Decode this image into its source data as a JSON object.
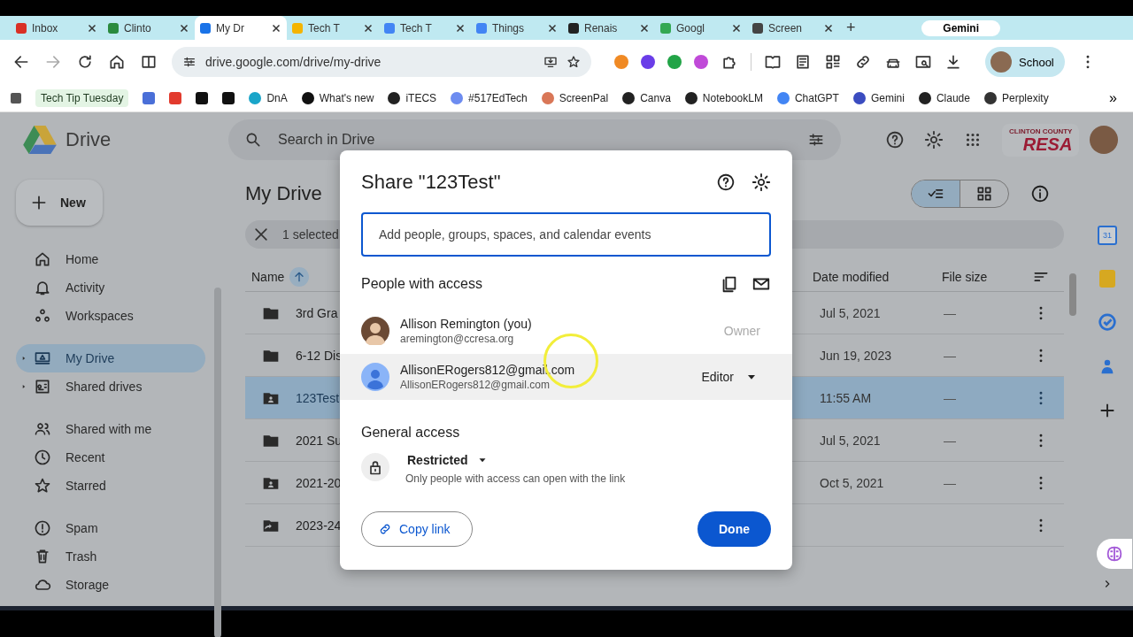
{
  "browser": {
    "tabs": [
      {
        "label": "Inbox",
        "selected": false
      },
      {
        "label": "Clinto",
        "selected": false
      },
      {
        "label": "My Dr",
        "selected": true
      },
      {
        "label": "Tech T",
        "selected": false
      },
      {
        "label": "Tech T",
        "selected": false
      },
      {
        "label": "Things",
        "selected": false
      },
      {
        "label": "Renais",
        "selected": false
      },
      {
        "label": "Googl",
        "selected": false
      },
      {
        "label": "Screen",
        "selected": false
      }
    ],
    "new_tab": "+",
    "gemini": "Gemini",
    "url": "drive.google.com/drive/my-drive",
    "profile": "School",
    "bookmarks": [
      {
        "kind": "chip",
        "label": "Tech Tip Tuesday"
      },
      {
        "kind": "icon"
      },
      {
        "kind": "icon"
      },
      {
        "kind": "icon"
      },
      {
        "kind": "icon"
      },
      {
        "kind": "site",
        "label": "DnA"
      },
      {
        "kind": "site",
        "label": "What's new"
      },
      {
        "kind": "site",
        "label": "iTECS"
      },
      {
        "kind": "site",
        "label": "#517EdTech"
      },
      {
        "kind": "site",
        "label": "ScreenPal"
      },
      {
        "kind": "site",
        "label": "Canva"
      },
      {
        "kind": "site",
        "label": "NotebookLM"
      },
      {
        "kind": "site",
        "label": "ChatGPT"
      },
      {
        "kind": "site",
        "label": "Gemini"
      },
      {
        "kind": "site",
        "label": "Claude"
      },
      {
        "kind": "site",
        "label": "Perplexity"
      }
    ],
    "more": "»"
  },
  "drive": {
    "app_name": "Drive",
    "search_placeholder": "Search in Drive",
    "new_button": "New",
    "org": {
      "small": "CLINTON COUNTY",
      "big": "RESA"
    },
    "nav_groups": [
      [
        {
          "kind": "home",
          "label": "Home",
          "selected": false
        },
        {
          "kind": "bell",
          "label": "Activity",
          "selected": false
        },
        {
          "kind": "workspaces",
          "label": "Workspaces",
          "selected": false
        }
      ],
      [
        {
          "kind": "mydrive",
          "label": "My Drive",
          "selected": true,
          "expandable": true
        },
        {
          "kind": "shared",
          "label": "Shared drives",
          "selected": false,
          "expandable": true
        }
      ],
      [
        {
          "kind": "people",
          "label": "Shared with me",
          "selected": false
        },
        {
          "kind": "clock",
          "label": "Recent",
          "selected": false
        },
        {
          "kind": "star",
          "label": "Starred",
          "selected": false
        }
      ],
      [
        {
          "kind": "spam",
          "label": "Spam",
          "selected": false
        },
        {
          "kind": "trash",
          "label": "Trash",
          "selected": false
        },
        {
          "kind": "cloud",
          "label": "Storage",
          "selected": false
        }
      ]
    ],
    "title": "My Drive",
    "selection": "1 selected",
    "columns": {
      "name": "Name",
      "date": "Date modified",
      "size": "File size"
    },
    "rows": [
      {
        "kind": "folder",
        "name": "3rd Gra",
        "date": "Jul 5, 2021",
        "size": "—",
        "selected": false
      },
      {
        "kind": "folder",
        "name": "6-12 Dis",
        "date": "Jun 19, 2023",
        "size": "—",
        "selected": false
      },
      {
        "kind": "shared",
        "name": "123Test",
        "date": "11:55 AM",
        "size": "—",
        "selected": true
      },
      {
        "kind": "folder",
        "name": "2021 Su",
        "date": "Jul 5, 2021",
        "size": "—",
        "selected": false
      },
      {
        "kind": "shared",
        "name": "2021-20",
        "date": "Oct 5, 2021",
        "size": "—",
        "selected": false
      },
      {
        "kind": "shortcut",
        "name": "2023-24",
        "selected": false
      }
    ],
    "calendar_day": "31"
  },
  "dialog": {
    "title": "Share \"123Test\"",
    "placeholder": "Add people, groups, spaces, and calendar events",
    "people_heading": "People with access",
    "people": [
      {
        "has_photo": true,
        "name": "Allison Remington (you)",
        "email": "aremington@ccresa.org",
        "role": "Owner",
        "kind": "owner",
        "hovered": false
      },
      {
        "has_photo": false,
        "name": "AllisonERogers812@gmail.com",
        "email": "AllisonERogers812@gmail.com",
        "role": "Editor",
        "kind": "editor",
        "hovered": true
      }
    ],
    "general_heading": "General access",
    "access": "Restricted",
    "access_note": "Only people with access can open with the link",
    "copy_link": "Copy link",
    "done": "Done"
  }
}
